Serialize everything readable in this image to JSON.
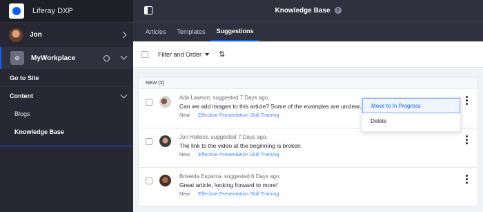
{
  "app": {
    "brand": "Liferay DXP",
    "colors": {
      "accent": "#0b5fff",
      "sidebar": "#272833",
      "topbar": "#30313f"
    }
  },
  "sidebar": {
    "user": "Jon",
    "workplace": "MyWorkplace",
    "go_to_site": "Go to Site",
    "section": "Content",
    "items": [
      {
        "label": "Blogs"
      },
      {
        "label": "Knowledge Base"
      }
    ]
  },
  "header": {
    "title": "Knowledge Base",
    "help_icon": "?"
  },
  "tabs": [
    {
      "label": "Articles"
    },
    {
      "label": "Templates"
    },
    {
      "label": "Suggestions"
    }
  ],
  "toolbar": {
    "filter_label": "Filter and Order",
    "sort_icon": "⇅"
  },
  "list": {
    "group_label": "NEW (3)",
    "rows": [
      {
        "meta": "Ada Lawson, suggested 7 Days ago.",
        "message": "Can we add images to this article? Some of the examples are unclear.",
        "status": "New",
        "course": "Effective Presentation Skill Training"
      },
      {
        "meta": "Jon Halleck, suggested 7 Days ago.",
        "message": "The link to the video at the beginning is broken.",
        "status": "New",
        "course": "Effective Presentation Skill Training"
      },
      {
        "meta": "Briseida Esparza, suggested 6 Days ago.",
        "message": "Great article, looking forward to more!",
        "status": "New",
        "course": "Effective Presentation Skill Training"
      }
    ]
  },
  "dropdown": {
    "items": [
      {
        "label": "Move to In Progress"
      },
      {
        "label": "Delete"
      }
    ]
  }
}
